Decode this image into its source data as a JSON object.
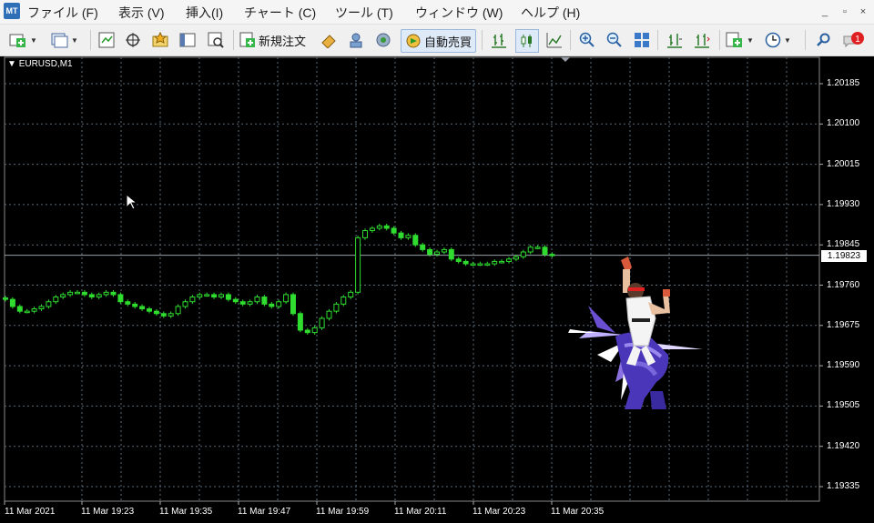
{
  "menu": {
    "items": [
      "ファイル (F)",
      "表示 (V)",
      "挿入(I)",
      "チャート (C)",
      "ツール (T)",
      "ウィンドウ (W)",
      "ヘルプ (H)"
    ]
  },
  "window_controls": {
    "minimize": "_",
    "restore": "▫",
    "close": "×"
  },
  "toolbar": {
    "new_order_label": "新規注文",
    "auto_trade_label": "自動売買",
    "notification_count": "1"
  },
  "chart": {
    "symbol": "EURUSD,M1",
    "current_price": "1.19823",
    "price_labels": [
      "1.20185",
      "1.20100",
      "1.20015",
      "1.19930",
      "1.19845",
      "1.19760",
      "1.19675",
      "1.19590",
      "1.19505",
      "1.19420",
      "1.19335"
    ],
    "time_labels": [
      "11 Mar 2021",
      "11 Mar 19:23",
      "11 Mar 19:35",
      "11 Mar 19:47",
      "11 Mar 19:59",
      "11 Mar 20:11",
      "11 Mar 20:23",
      "11 Mar 20:35"
    ],
    "colors": {
      "background": "#000000",
      "grid": "#5a6a7a",
      "candle": "#2fdc2f",
      "text": "#ffffff"
    }
  },
  "chart_data": {
    "type": "candlestick",
    "series_close": [
      1.1973,
      1.19715,
      1.19705,
      1.19705,
      1.1971,
      1.19715,
      1.19725,
      1.19735,
      1.1974,
      1.19745,
      1.19745,
      1.1974,
      1.19735,
      1.1974,
      1.19745,
      1.1974,
      1.19725,
      1.1972,
      1.19715,
      1.1971,
      1.19705,
      1.197,
      1.19695,
      1.197,
      1.19715,
      1.19725,
      1.19735,
      1.1974,
      1.1974,
      1.19735,
      1.1974,
      1.1973,
      1.19725,
      1.1972,
      1.19725,
      1.19735,
      1.1972,
      1.19715,
      1.19725,
      1.1974,
      1.197,
      1.19665,
      1.1966,
      1.1967,
      1.1969,
      1.19705,
      1.1972,
      1.19735,
      1.19745,
      1.1986,
      1.19875,
      1.1988,
      1.19885,
      1.1988,
      1.1987,
      1.1986,
      1.19865,
      1.19845,
      1.19835,
      1.19825,
      1.1983,
      1.19835,
      1.19815,
      1.1981,
      1.19805,
      1.19805,
      1.19805,
      1.19805,
      1.1981,
      1.1981,
      1.19815,
      1.1982,
      1.1983,
      1.1984,
      1.1984,
      1.19825,
      1.19823
    ],
    "ylim": [
      1.193,
      1.2023
    ],
    "ylabel_ticks": [
      1.20185,
      1.201,
      1.20015,
      1.1993,
      1.19845,
      1.1976,
      1.19675,
      1.1959,
      1.19505,
      1.1942,
      1.19335
    ],
    "xlabel_ticks": [
      "11 Mar 2021",
      "11 Mar 19:23",
      "11 Mar 19:35",
      "11 Mar 19:47",
      "11 Mar 19:59",
      "11 Mar 20:11",
      "11 Mar 20:23",
      "11 Mar 20:35"
    ],
    "grid": true
  }
}
